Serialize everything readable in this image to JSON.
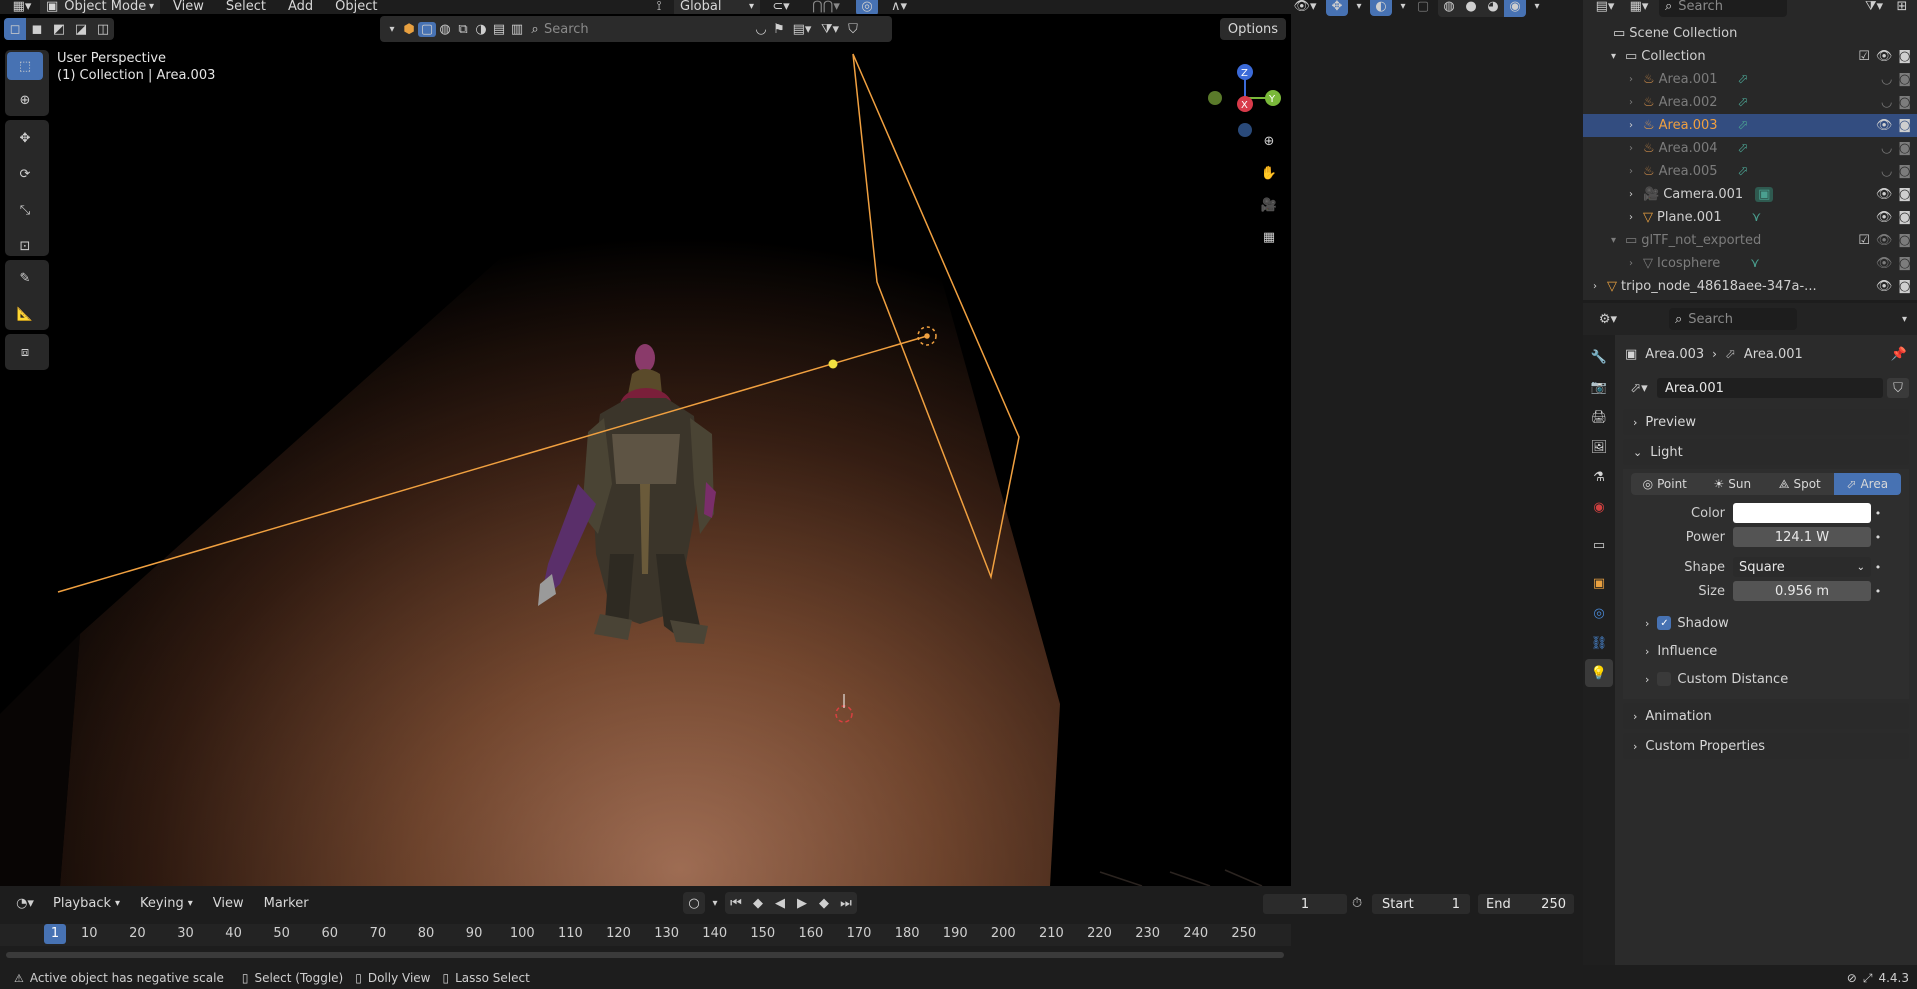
{
  "header": {
    "mode": "Object Mode",
    "menus": [
      "View",
      "Select",
      "Add",
      "Object"
    ],
    "orientation": "Global",
    "options_label": "Options",
    "search_placeholder": "Search"
  },
  "viewport": {
    "perspective": "User Perspective",
    "collection_info": "(1) Collection | Area.003",
    "gizmo": {
      "z": "Z",
      "y": "Y",
      "x": "X"
    }
  },
  "outliner": {
    "search_placeholder": "Search",
    "items": [
      {
        "name": "Scene Collection"
      },
      {
        "name": "Collection"
      },
      {
        "name": "Area.001"
      },
      {
        "name": "Area.002"
      },
      {
        "name": "Area.003"
      },
      {
        "name": "Area.004"
      },
      {
        "name": "Area.005"
      },
      {
        "name": "Camera.001"
      },
      {
        "name": "Plane.001"
      },
      {
        "name": "glTF_not_exported"
      },
      {
        "name": "Icosphere"
      },
      {
        "name": "tripo_node_48618aee-347a-..."
      }
    ]
  },
  "properties": {
    "search_placeholder": "Search",
    "breadcrumb_object": "Area.003",
    "breadcrumb_data": "Area.001",
    "datablock": "Area.001",
    "panels": {
      "preview": "Preview",
      "light": "Light",
      "shadow": "Shadow",
      "influence": "Influence",
      "custom_distance": "Custom Distance",
      "animation": "Animation",
      "custom_properties": "Custom Properties"
    },
    "light_types": [
      "Point",
      "Sun",
      "Spot",
      "Area"
    ],
    "active_light_type": "Area",
    "color_label": "Color",
    "color_value": "#ffffff",
    "power_label": "Power",
    "power_value": "124.1 W",
    "shape_label": "Shape",
    "shape_value": "Square",
    "size_label": "Size",
    "size_value": "0.956 m",
    "shadow_checked": true,
    "custom_distance_checked": false
  },
  "timeline": {
    "menus": [
      "Playback",
      "Keying",
      "View",
      "Marker"
    ],
    "current_frame": "1",
    "start_label": "Start",
    "start_value": "1",
    "end_label": "End",
    "end_value": "250",
    "ticks": [
      "10",
      "20",
      "30",
      "40",
      "50",
      "60",
      "70",
      "80",
      "90",
      "100",
      "110",
      "120",
      "130",
      "140",
      "150",
      "160",
      "170",
      "180",
      "190",
      "200",
      "210",
      "220",
      "230",
      "240",
      "250"
    ],
    "playhead": "1"
  },
  "statusbar": {
    "message": "Active object has negative scale",
    "hint1": "Select (Toggle)",
    "hint2": "Dolly View",
    "hint3": "Lasso Select",
    "version": "4.4.3"
  },
  "colors": {
    "accent": "#4772b3",
    "selection_outline": "#f0a040",
    "outliner_selected": "#334d80"
  }
}
